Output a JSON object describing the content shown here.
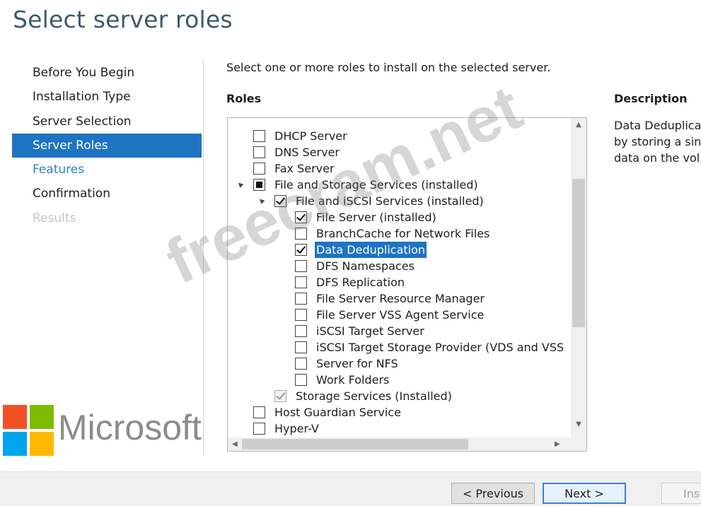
{
  "window": {
    "title": "Select server roles"
  },
  "nav": {
    "items": [
      {
        "label": "Before You Begin",
        "state": "normal"
      },
      {
        "label": "Installation Type",
        "state": "normal"
      },
      {
        "label": "Server Selection",
        "state": "normal"
      },
      {
        "label": "Server Roles",
        "state": "active"
      },
      {
        "label": "Features",
        "state": "link"
      },
      {
        "label": "Confirmation",
        "state": "normal"
      },
      {
        "label": "Results",
        "state": "disabled"
      }
    ]
  },
  "main": {
    "instruction": "Select one or more roles to install on the selected server.",
    "roles_heading": "Roles",
    "description_heading": "Description",
    "description_lines": [
      "Data Deduplica",
      "by storing a sin",
      "data on the vol"
    ]
  },
  "roles": [
    {
      "label": "DHCP Server",
      "level": 0,
      "checkbox": "unchecked",
      "expander": ""
    },
    {
      "label": "DNS Server",
      "level": 0,
      "checkbox": "unchecked",
      "expander": ""
    },
    {
      "label": "Fax Server",
      "level": 0,
      "checkbox": "unchecked",
      "expander": ""
    },
    {
      "label": "File and Storage Services  (installed)",
      "level": 0,
      "checkbox": "partial",
      "expander": "▲"
    },
    {
      "label": "File and iSCSI Services (installed)",
      "level": 1,
      "checkbox": "checked",
      "expander": "▲"
    },
    {
      "label": "File Server  (installed)",
      "level": 2,
      "checkbox": "checked",
      "expander": ""
    },
    {
      "label": "BranchCache for Network Files",
      "level": 2,
      "checkbox": "unchecked",
      "expander": ""
    },
    {
      "label": "Data Deduplication",
      "level": 2,
      "checkbox": "checked",
      "expander": "",
      "selected": true
    },
    {
      "label": "DFS Namespaces",
      "level": 2,
      "checkbox": "unchecked",
      "expander": ""
    },
    {
      "label": "DFS Replication",
      "level": 2,
      "checkbox": "unchecked",
      "expander": ""
    },
    {
      "label": "File Server Resource Manager",
      "level": 2,
      "checkbox": "unchecked",
      "expander": ""
    },
    {
      "label": "File Server VSS Agent Service",
      "level": 2,
      "checkbox": "unchecked",
      "expander": ""
    },
    {
      "label": "iSCSI Target Server",
      "level": 2,
      "checkbox": "unchecked",
      "expander": ""
    },
    {
      "label": "iSCSI Target Storage Provider (VDS and VSS",
      "level": 2,
      "checkbox": "unchecked",
      "expander": ""
    },
    {
      "label": "Server for NFS",
      "level": 2,
      "checkbox": "unchecked",
      "expander": ""
    },
    {
      "label": "Work Folders",
      "level": 2,
      "checkbox": "unchecked",
      "expander": ""
    },
    {
      "label": "Storage Services (Installed)",
      "level": 1,
      "checkbox": "disabled-checked",
      "expander": ""
    },
    {
      "label": "Host Guardian Service",
      "level": 0,
      "checkbox": "unchecked",
      "expander": ""
    },
    {
      "label": "Hyper-V",
      "level": 0,
      "checkbox": "unchecked",
      "expander": ""
    }
  ],
  "footer": {
    "previous_label": "< Previous",
    "next_label": "Next >",
    "install_label": "Ins"
  },
  "branding": {
    "logo_text": "Microsoft",
    "logo_colors": [
      "#f25022",
      "#7fba00",
      "#00a4ef",
      "#ffb900"
    ],
    "watermark": "freecram.net"
  },
  "colors": {
    "accent": "#1e73c3",
    "title": "#3a5a6e"
  },
  "icons": {
    "scroll_up": "▲",
    "scroll_down": "▼",
    "scroll_left": "◀",
    "scroll_right": "▶"
  }
}
